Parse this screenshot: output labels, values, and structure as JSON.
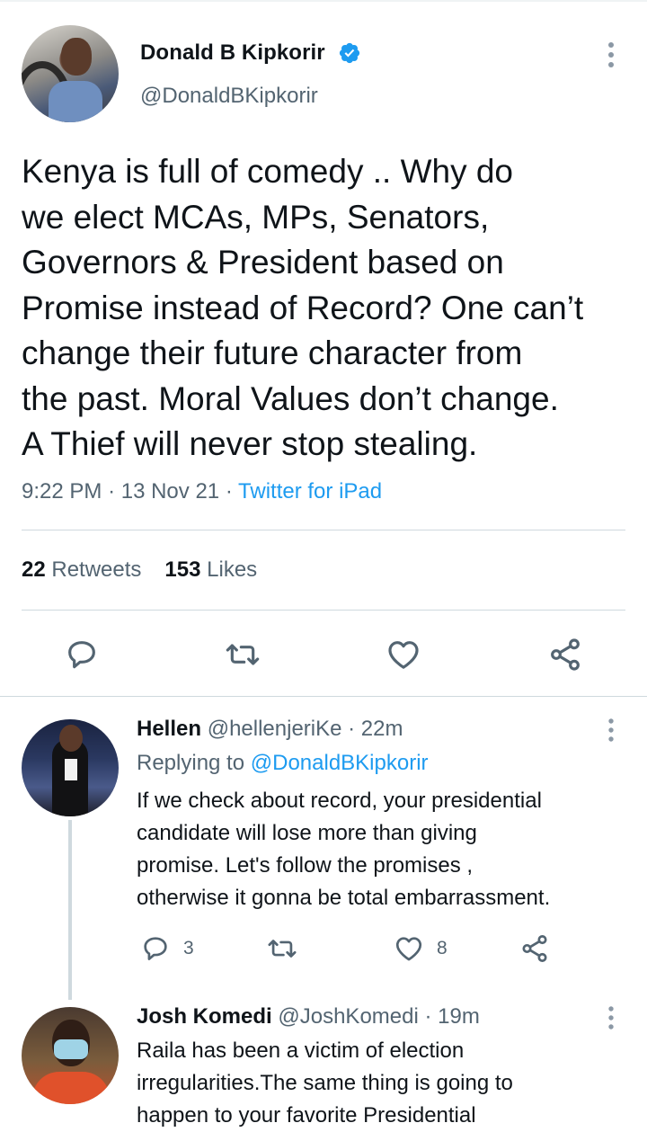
{
  "tweet": {
    "author_name": "Donald B Kipkorir",
    "author_handle": "@DonaldBKipkorir",
    "verified_icon": "verified-badge-icon",
    "text_lines": [
      "Kenya is full of comedy .. Why do",
      "we elect MCAs, MPs, Senators,",
      "Governors & President based on",
      "Promise instead of Record? One can’t",
      "change their future character from",
      "the past. Moral Values don’t change.",
      "A Thief will never stop stealing."
    ],
    "time": "9:22 PM",
    "dot": "·",
    "date": "13 Nov 21",
    "source": "Twitter for iPad",
    "retweets_count": "22",
    "retweets_label": "Retweets",
    "likes_count": "153",
    "likes_label": "Likes"
  },
  "actions": [
    "reply-icon",
    "retweet-icon",
    "like-icon",
    "share-icon"
  ],
  "colors": {
    "accent": "#1d9bf0",
    "secondary_text": "#536471",
    "divider": "#cfd9de"
  },
  "replies": [
    {
      "name": "Hellen",
      "handle": "@hellenjeriKe · 22m",
      "replying_label": "Replying to",
      "replying_to": "@DonaldBKipkorir",
      "text_lines": [
        "If we check about record, your presidential",
        "candidate will lose more than giving",
        "promise. Let's follow the promises ,",
        "otherwise it gonna be total embarrassment."
      ],
      "reply_count": "3",
      "like_count": "8"
    },
    {
      "name": "Josh Komedi",
      "handle": "@JoshKomedi · 19m",
      "text_lines": [
        "Raila has been a victim of election",
        "irregularities.The same thing is going to",
        "happen to your favorite Presidential"
      ]
    }
  ]
}
